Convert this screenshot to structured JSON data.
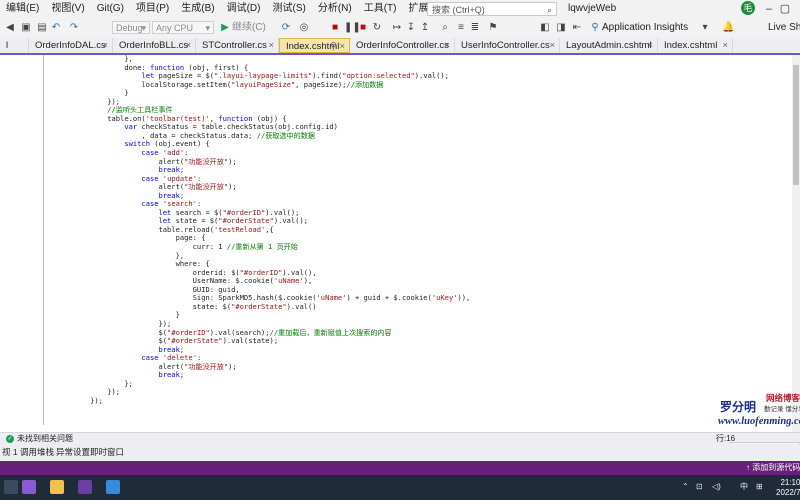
{
  "menu": {
    "items": [
      "编辑(E)",
      "视图(V)",
      "Git(G)",
      "项目(P)",
      "生成(B)",
      "调试(D)",
      "测试(S)",
      "分析(N)",
      "工具(T)",
      "扩展(X)",
      "窗口(W)",
      "帮助(H)"
    ],
    "search_placeholder": "搜索 (Ctrl+Q)",
    "solution_name": "lqwvjeWeb",
    "user_initial": "毛"
  },
  "toolbar": {
    "config": "Debug",
    "platform": "Any CPU",
    "continue_label": "继续(C)",
    "app_insights": "Application Insights",
    "live_share": "Live Sh"
  },
  "tabs": [
    "OrderInfoDAL.cs",
    "OrderInfoBLL.cs",
    "STController.cs",
    "Index.cshtml",
    "OrderInfoController.cs",
    "UserInfoController.cs",
    "LayoutAdmin.cshtml",
    "Index.cshtml"
  ],
  "active_tab": "Index.cshtml",
  "code_lines": [
    "                },",
    "                done: function (obj, first) {",
    "                    let pageSize = $(\".layui-laypage-limits\").find(\"option:selected\").val();",
    "                    localStorage.setItem(\"layuiPageSize\", pageSize);//添加数据",
    "                }",
    "            });",
    "            //监听头工具栏事件",
    "            table.on('toolbar(test)', function (obj) {",
    "                var checkStatus = table.checkStatus(obj.config.id)",
    "                    , data = checkStatus.data; //获取选中的数据",
    "                switch (obj.event) {",
    "                    case 'add':",
    "                        alert(\"功能没开放\");",
    "                        break;",
    "                    case 'update':",
    "                        alert(\"功能没开放\");",
    "                        break;",
    "                    case 'search':",
    "                        let search = $(\"#orderID\").val();",
    "                        let state = $(\"#orderState\").val();",
    "                        table.reload('testReload',{",
    "                            page: {",
    "                                curr: 1 //重新从第 1 页开始",
    "                            },",
    "                            where: {",
    "                                orderid: $(\"#orderID\").val(),",
    "                                UserName: $.cookie('uName'),",
    "                                GUID: guid,",
    "                                Sign: SparkMD5.hash($.cookie('uName') + guid + $.cookie('uKey')),",
    "                                state: $(\"#orderState\").val()",
    "                            }",
    "                        });",
    "                        $(\"#orderID\").val(search);//重加载后，重新赋值上次搜索的内容",
    "                        $(\"#orderState\").val(state);",
    "                        break;",
    "                    case 'delete':",
    "                        alert(\"功能没开放\");",
    "                        break;",
    "                };",
    "            });",
    "        });"
  ],
  "watermark": {
    "name": "罗分明",
    "side1": "网络博客",
    "side2": "勤记录 懂分享",
    "url": "www.luofenming.com"
  },
  "editor_status": {
    "issues": "未找到相关问题",
    "position": "行:16"
  },
  "ime": "五",
  "bottom_tabs": [
    "视 1",
    "调用堆栈",
    "异常设置",
    "即时窗口"
  ],
  "vs_status": "添加到源代码管理",
  "tray": {
    "lang": "中",
    "time": "21:10",
    "date": "2022/7"
  },
  "colors": {
    "accent": "#68217a",
    "tab_active_bg": "#f5e6a8",
    "comment": "#008000",
    "string": "#a31515"
  }
}
